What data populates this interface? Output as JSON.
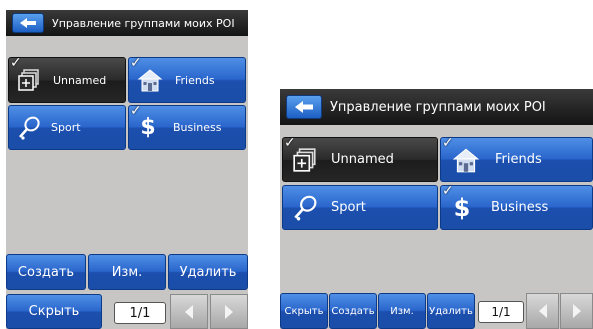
{
  "screens": [
    {
      "title": "Управление группами моих POI",
      "groups": [
        {
          "name": "Unnamed",
          "icon": "folder-plus-icon",
          "checked": true,
          "selected": true
        },
        {
          "name": "Friends",
          "icon": "house-icon",
          "checked": true,
          "selected": false
        },
        {
          "name": "Sport",
          "icon": "tennis-racket-icon",
          "checked": false,
          "selected": false
        },
        {
          "name": "Business",
          "icon": "dollar-icon",
          "checked": true,
          "selected": false
        }
      ],
      "buttons": {
        "create": "Создать",
        "edit": "Изм.",
        "delete": "Удалить",
        "hide": "Скрыть"
      },
      "pager": "1/1"
    },
    {
      "title": "Управление группами моих POI",
      "groups": [
        {
          "name": "Unnamed",
          "icon": "folder-plus-icon",
          "checked": true,
          "selected": true
        },
        {
          "name": "Friends",
          "icon": "house-icon",
          "checked": true,
          "selected": false
        },
        {
          "name": "Sport",
          "icon": "tennis-racket-icon",
          "checked": false,
          "selected": false
        },
        {
          "name": "Business",
          "icon": "dollar-icon",
          "checked": true,
          "selected": false
        }
      ],
      "buttons": {
        "create": "Создать",
        "edit": "Изм.",
        "delete": "Удалить",
        "hide": "Скрыть"
      },
      "pager": "1/1"
    }
  ],
  "colors": {
    "accent": "#2a66cc",
    "titlebar": "#1e1e1e",
    "panel": "#c8c5c5",
    "selected": "#262626"
  }
}
